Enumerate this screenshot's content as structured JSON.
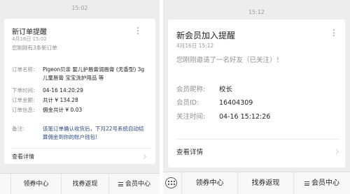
{
  "left": {
    "time": "15:02",
    "card": {
      "title": "新订单提醒",
      "date": "4月16日 15:02",
      "desc": "您刚刚有3条新订单",
      "rows": [
        {
          "label": "订单名称:",
          "value": "Pigeon贝亲 婴儿护唇膏润唇膏 (无香型) 3g儿童唇膏 宝宝洗护用品 等"
        },
        {
          "label": "下单时间:",
          "value": "04-16 14:20:29"
        },
        {
          "label": "订单金额:",
          "value": "共计 ¥ 134.28"
        },
        {
          "label": "订单信息:",
          "value": "佣金共计 ¥ 0.03"
        },
        {
          "label": "备注:",
          "value": "该笔订单确认收货后，下月22号系统自动结算佣金到你的账户钱包!"
        }
      ],
      "detail_label": "查看详情"
    },
    "bottom_bar": {
      "buttons": [
        "领券中心",
        "找券返现",
        "会员中心"
      ]
    }
  },
  "right": {
    "time": "15:12",
    "card": {
      "title": "新会员加入提醒",
      "date": "4月16日 15:12",
      "desc": "您刚刚邀请了一名好友（已关注）！",
      "rows": [
        {
          "label": "会员昵称:",
          "value": "校长"
        },
        {
          "label": "会员ID:",
          "value": "16404309"
        },
        {
          "label": "关注时间:",
          "value": "04-16 15:12:26"
        }
      ],
      "detail_label": "查看详情"
    },
    "bottom_bar": {
      "buttons": [
        "领券中心",
        "找券返现",
        "会员中心"
      ]
    }
  }
}
